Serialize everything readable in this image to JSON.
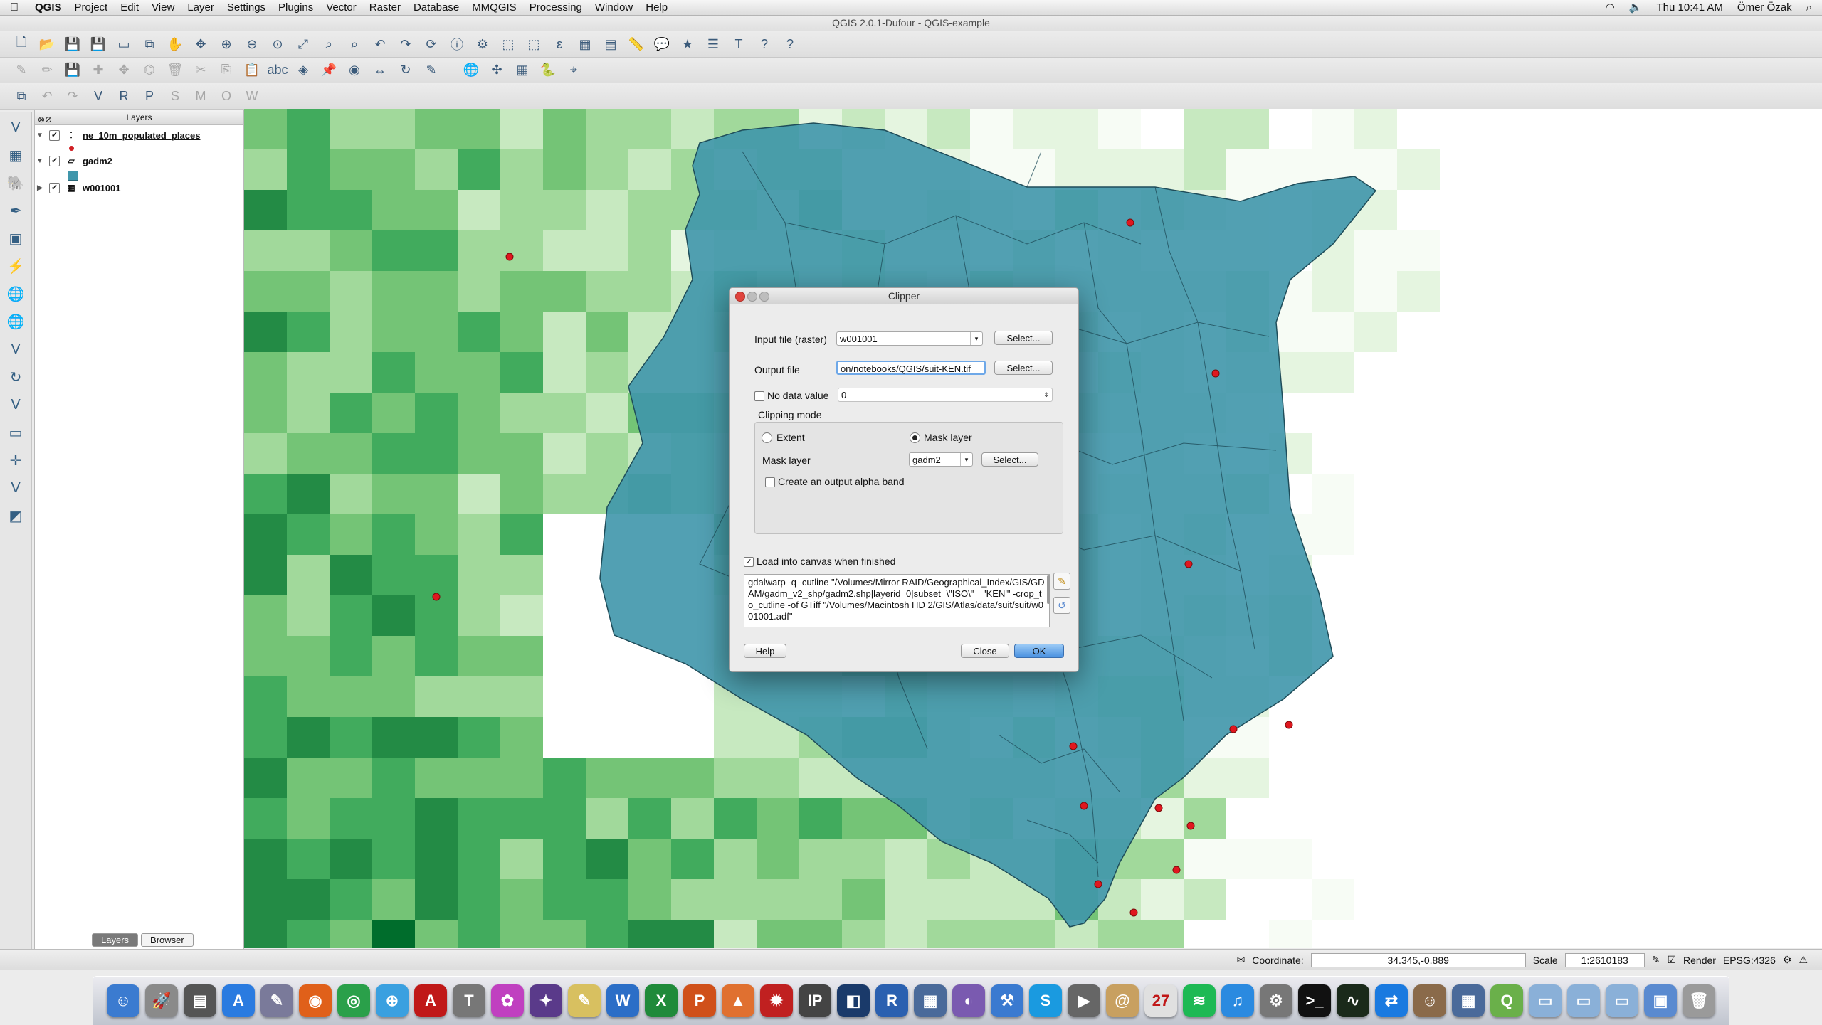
{
  "menubar": {
    "app": "QGIS",
    "items": [
      "Project",
      "Edit",
      "View",
      "Layer",
      "Settings",
      "Plugins",
      "Vector",
      "Raster",
      "Database",
      "MMQGIS",
      "Processing",
      "Window",
      "Help"
    ],
    "clock": "Thu 10:41 AM",
    "user": "Ömer Özak"
  },
  "window": {
    "title": "QGIS 2.0.1-Dufour - QGIS-example"
  },
  "layers_panel": {
    "title": "Layers",
    "items": [
      {
        "name": "ne_10m_populated_places",
        "checked": true
      },
      {
        "name": "gadm2",
        "checked": true
      },
      {
        "name": "w001001",
        "checked": true
      }
    ],
    "tabs": [
      "Layers",
      "Browser"
    ]
  },
  "dialog": {
    "title": "Clipper",
    "input_label": "Input file (raster)",
    "input_value": "w001001",
    "select_label": "Select...",
    "output_label": "Output file",
    "output_value": "on/notebooks/QGIS/suit-KEN.tif",
    "nodata_label": "No data value",
    "nodata_value": "0",
    "clipping_mode_label": "Clipping mode",
    "extent_label": "Extent",
    "mask_layer_radio_label": "Mask layer",
    "mask_layer_label": "Mask layer",
    "mask_layer_value": "gadm2",
    "alpha_label": "Create an output alpha band",
    "load_label": "Load into canvas when finished",
    "command": "gdalwarp -q -cutline \"/Volumes/Mirror RAID/Geographical_Index/GIS/GDAM/gadm_v2_shp/gadm2.shp|layerid=0|subset=\\\"ISO\\\" = 'KEN'\" -crop_to_cutline -of GTiff \"/Volumes/Macintosh HD 2/GIS/Atlas/data/suit/suit/w001001.adf\"",
    "help": "Help",
    "close": "Close",
    "ok": "OK"
  },
  "statusbar": {
    "coordinate_label": "Coordinate:",
    "coordinate_value": "34.345,-0.889",
    "scale_label": "Scale",
    "scale_value": "1:2610183",
    "render_label": "Render",
    "crs": "EPSG:4326"
  },
  "colors": {
    "kenya_fill": "#3f96ab",
    "green_dark": "#006d2c",
    "green_light": "#e5f5e0",
    "point": "#e0171f"
  }
}
